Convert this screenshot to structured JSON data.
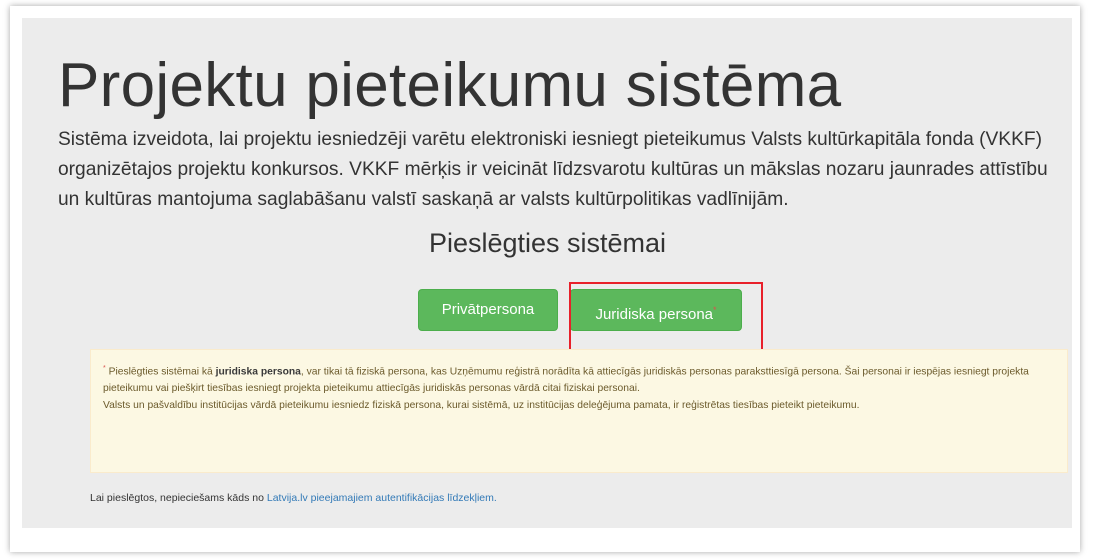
{
  "header": {
    "title": "Projektu pieteikumu sistēma",
    "intro": "Sistēma izveidota, lai projektu iesniedzēji varētu elektroniski iesniegt pieteikumus Valsts kultūrkapitāla fonda (VKKF) organizētajos projektu konkursos. VKKF mērķis ir veicināt līdzsvarotu kultūras un mākslas nozaru jaunrades attīstību un kultūras mantojuma saglabāšanu valstī saskaņā ar valsts kultūrpolitikas vadlīnijām."
  },
  "login": {
    "heading": "Pieslēgties sistēmai",
    "private_label": "Privātpersona",
    "legal_label": "Juridiska persona",
    "legal_marker": "*"
  },
  "notice": {
    "marker": "*",
    "p1_before": " Pieslēgties sistēmai kā ",
    "p1_bold": "juridiska persona",
    "p1_after": ", var tikai tā fiziskā persona, kas Uzņēmumu reģistrā norādīta kā attiecīgās juridiskās personas paraksttiesīgā persona. Šai personai ir iespējas iesniegt projekta pieteikumu vai piešķirt tiesības iesniegt projekta pieteikumu attiecīgās juridiskās personas vārdā citai fiziskai personai.",
    "p2": "Valsts un pašvaldību institūcijas vārdā pieteikumu iesniedz fiziskā persona, kurai sistēmā, uz institūcijas deleģējuma pamata, ir reģistrētas tiesības pieteikt pieteikumu."
  },
  "footer": {
    "text": "Lai pieslēgtos, nepieciešams kāds no ",
    "link": "Latvija.lv pieejamajiem autentifikācijas līdzekļiem."
  },
  "colors": {
    "button_green": "#5cb85c",
    "highlight_red": "#e8202a",
    "notice_bg": "#fcf8e3",
    "link_blue": "#337ab7"
  }
}
